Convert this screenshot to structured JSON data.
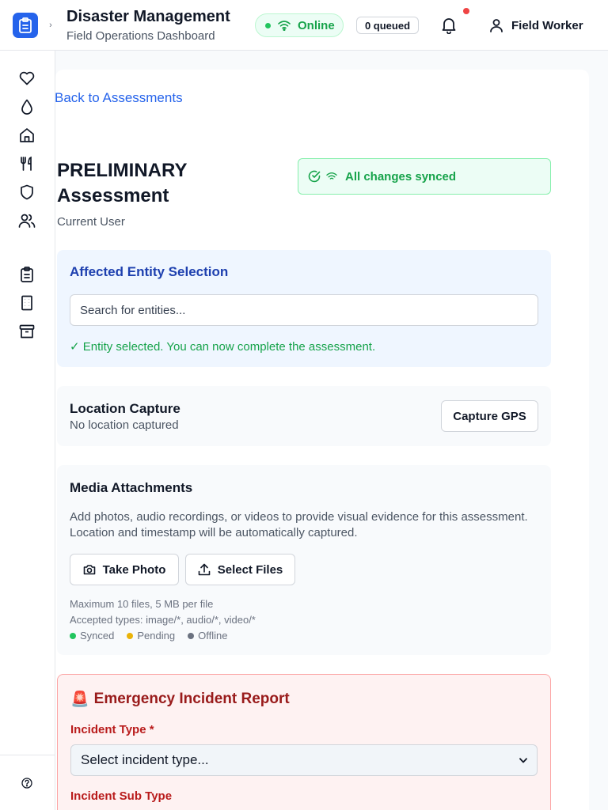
{
  "header": {
    "title": "Disaster Management",
    "subtitle": "Field Operations Dashboard",
    "status_label": "Online",
    "queue_label": "0 queued",
    "user_label": "Field Worker"
  },
  "sidebar": {
    "items": [
      {
        "icon": "heart-icon"
      },
      {
        "icon": "droplet-icon"
      },
      {
        "icon": "home-icon"
      },
      {
        "icon": "utensils-icon"
      },
      {
        "icon": "shield-icon"
      },
      {
        "icon": "users-icon"
      },
      {
        "icon": "clipboard-icon"
      },
      {
        "icon": "building-icon"
      },
      {
        "icon": "archive-icon"
      }
    ],
    "help_icon": "help-circle-icon"
  },
  "main": {
    "back_link": "Back to Assessments",
    "assessment_title": "PRELIMINARY Assessment",
    "assessment_user": "Current User",
    "sync_status": "All changes synced"
  },
  "entity": {
    "title": "Affected Entity Selection",
    "search_placeholder": "Search for entities...",
    "selected_message": "✓ Entity selected. You can now complete the assessment."
  },
  "location": {
    "title": "Location Capture",
    "status": "No location captured",
    "capture_button": "Capture GPS"
  },
  "media": {
    "title": "Media Attachments",
    "description": "Add photos, audio recordings, or videos to provide visual evidence for this assessment. Location and timestamp will be automatically captured.",
    "take_photo": "Take Photo",
    "select_files": "Select Files",
    "limits": "Maximum 10 files, 5 MB per file",
    "accepted": "Accepted types: image/*, audio/*, video/*",
    "legend": [
      {
        "label": "Synced",
        "color": "#22c55e"
      },
      {
        "label": "Pending",
        "color": "#eab308"
      },
      {
        "label": "Offline",
        "color": "#6b7280"
      }
    ]
  },
  "emergency": {
    "emoji": "🚨",
    "title": "Emergency Incident Report",
    "incident_type_label": "Incident Type *",
    "incident_type_value": "Select incident type...",
    "incident_subtype_label": "Incident Sub Type"
  },
  "colors": {
    "brand": "#2563eb",
    "online": "#16a34a",
    "alert": "#ef4444",
    "emergency": "#991b1b"
  }
}
